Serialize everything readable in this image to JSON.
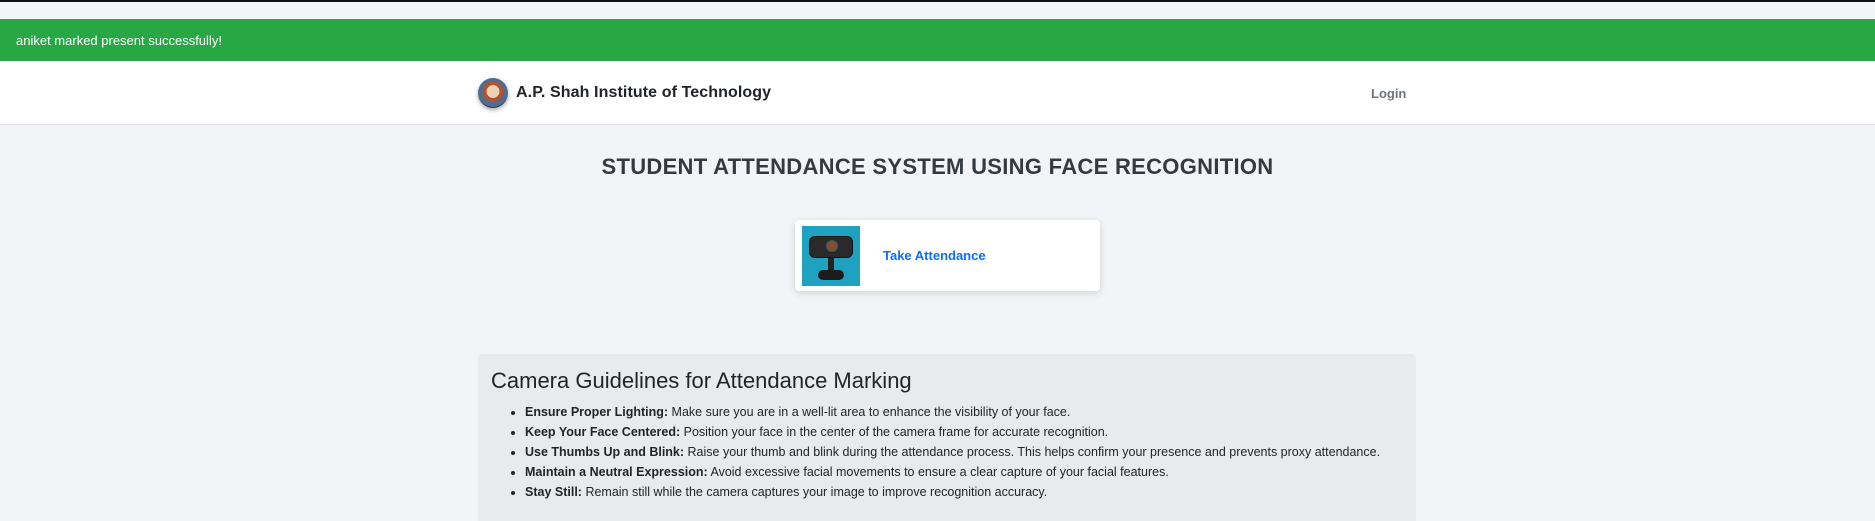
{
  "alert": {
    "message": "aniket marked present successfully!"
  },
  "navbar": {
    "brand_name": "A.P. Shah Institute of Technology",
    "login_label": "Login"
  },
  "page": {
    "title": "STUDENT ATTENDANCE SYSTEM USING FACE RECOGNITION"
  },
  "card": {
    "label": "Take Attendance",
    "image_icon": "webcam-image"
  },
  "guidelines": {
    "heading": "Camera Guidelines for Attendance Marking",
    "items": [
      {
        "title": "Ensure Proper Lighting:",
        "text": " Make sure you are in a well-lit area to enhance the visibility of your face."
      },
      {
        "title": "Keep Your Face Centered:",
        "text": " Position your face in the center of the camera frame for accurate recognition."
      },
      {
        "title": "Use Thumbs Up and Blink:",
        "text": " Raise your thumb and blink during the attendance process. This helps confirm your presence and prevents proxy attendance."
      },
      {
        "title": "Maintain a Neutral Expression:",
        "text": " Avoid excessive facial movements to ensure a clear capture of your facial features."
      },
      {
        "title": "Stay Still:",
        "text": " Remain still while the camera captures your image to improve recognition accuracy."
      }
    ]
  },
  "colors": {
    "alert_bg": "#28a745",
    "link": "#0d6efd",
    "page_bg": "#f3f4f7",
    "panel_bg": "#e8eaee"
  }
}
